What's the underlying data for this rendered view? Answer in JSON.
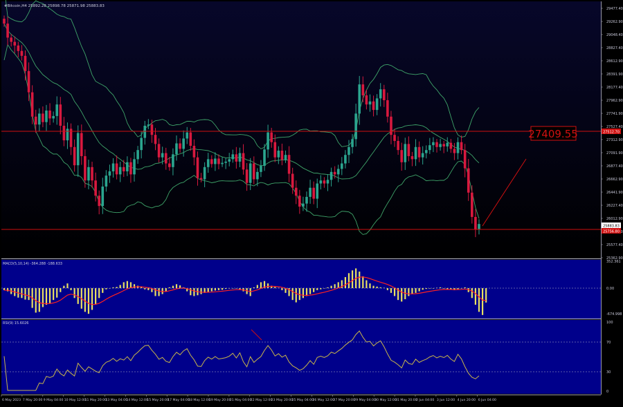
{
  "colors": {
    "main_bg_top": "#07072a",
    "main_bg_bottom": "#000000",
    "ind_bg": "#00008b",
    "bull": "#2ba58f",
    "bear": "#d8193e",
    "bands": "#3fa56a",
    "hline": "#d01010",
    "macd_hist": "#e8e062",
    "macd_signal": "#ff2020",
    "rsi_line": "#c9b64a",
    "axis_text": "#c8c8d8",
    "separator": "#b8b8c8"
  },
  "header": {
    "main_title": "#Bitcoin,H4  25892.28 25898.78 25871.98 25883.83",
    "macd_title": "MACD(5,10,14) -364.288 -188.633",
    "rsi_title": "RSI(9) 15.6026"
  },
  "price_axis": [
    "29477.40",
    "29262.90",
    "29048.40",
    "28827.40",
    "28612.90",
    "28391.90",
    "28177.40",
    "27962.90",
    "27741.90",
    "27527.40",
    "27312.90",
    "27091.90",
    "26877.40",
    "26662.90",
    "26441.90",
    "26227.40",
    "26012.90",
    "25798.40",
    "25577.40",
    "25362.90"
  ],
  "price_tags": {
    "level_high": "27512.70",
    "current": "25883.83",
    "level_low": "25756.80"
  },
  "big_label": "27409.55",
  "macd_axis": [
    "352.361",
    "0.00",
    "-674.998"
  ],
  "rsi_axis": [
    "100",
    "70",
    "30",
    "0"
  ],
  "time_axis": [
    "6 May 2023",
    "7 May 20:00",
    "9 May 04:00",
    "10 May 12:00",
    "11 May 20:00",
    "13 May 04:00",
    "14 May 12:00",
    "15 May 20:00",
    "17 May 04:00",
    "18 May 12:00",
    "19 May 20:00",
    "21 May 04:00",
    "22 May 12:00",
    "23 May 20:00",
    "25 May 04:00",
    "26 May 12:00",
    "27 May 20:00",
    "29 May 04:00",
    "30 May 12:00",
    "31 May 20:00",
    "2 Jun 04:00",
    "3 Jun 12:00",
    "4 Jun 20:00",
    "6 Jun 04:00"
  ],
  "chart_data": {
    "type": "candlestick",
    "symbol": "#Bitcoin",
    "timeframe": "H4",
    "price_range": [
      25362.9,
      29477.4
    ],
    "horizontal_levels": [
      27409.55,
      25830.0
    ],
    "closes": [
      29180,
      28950,
      28880,
      28820,
      28730,
      28650,
      28400,
      28050,
      27650,
      27520,
      27700,
      27560,
      27750,
      27620,
      27660,
      27850,
      27500,
      27260,
      27450,
      27150,
      26850,
      27380,
      27000,
      26600,
      26820,
      26600,
      26350,
      26180,
      26500,
      26680,
      26750,
      26880,
      26700,
      26820,
      26750,
      26900,
      26700,
      26950,
      27100,
      27300,
      27500,
      27520,
      27350,
      27200,
      26980,
      27050,
      26880,
      26820,
      27030,
      27210,
      27120,
      27290,
      27390,
      27170,
      26980,
      26640,
      26620,
      26820,
      26950,
      26870,
      26960,
      26870,
      26890,
      26910,
      26950,
      27030,
      26910,
      27050,
      26780,
      26560,
      26880,
      26620,
      26740,
      26840,
      27110,
      27390,
      27230,
      26980,
      27090,
      26940,
      27020,
      26710,
      26480,
      26350,
      26170,
      26220,
      26330,
      26480,
      26300,
      26550,
      26600,
      26550,
      26610,
      26740,
      26700,
      26790,
      26880,
      27020,
      27150,
      27280,
      27700,
      28180,
      28000,
      27850,
      27900,
      27760,
      27950,
      28100,
      27920,
      27650,
      27350,
      27250,
      27100,
      26900,
      27200,
      27000,
      26950,
      27150,
      26980,
      27050,
      27100,
      27180,
      27230,
      27150,
      27200,
      27160,
      27220,
      27120,
      27050,
      27230,
      27100,
      26800,
      26400,
      26000,
      25800,
      25883.83
    ],
    "macd_hist": [
      -50,
      -80,
      -150,
      -200,
      -240,
      -250,
      -290,
      -300,
      -500,
      -620,
      -600,
      -480,
      -420,
      -380,
      -300,
      -240,
      -100,
      60,
      120,
      -50,
      -250,
      -400,
      -520,
      -600,
      -650,
      -550,
      -400,
      -250,
      -120,
      -30,
      -10,
      20,
      30,
      80,
      150,
      180,
      150,
      100,
      60,
      40,
      -30,
      -50,
      -100,
      -200,
      -200,
      -150,
      -80,
      20,
      60,
      100,
      70,
      20,
      -80,
      -180,
      -200,
      -180,
      -150,
      -120,
      -100,
      -80,
      -60,
      -50,
      -40,
      -20,
      -10,
      -5,
      -3,
      -30,
      -80,
      -150,
      -200,
      20,
      80,
      150,
      180,
      120,
      60,
      30,
      10,
      -50,
      -120,
      -200,
      -300,
      -360,
      -300,
      -250,
      -200,
      -150,
      -100,
      -50,
      -30,
      -10,
      20,
      60,
      100,
      150,
      200,
      280,
      380,
      450,
      500,
      420,
      300,
      200,
      120,
      60,
      40,
      20,
      10,
      -50,
      -120,
      -200,
      -300,
      -340,
      -280,
      -200,
      -150,
      -120,
      -80,
      -40,
      -20,
      -10,
      0,
      10,
      20,
      -5,
      -30,
      -40,
      -50,
      -30,
      -10,
      20,
      -100,
      -250,
      -420,
      -600,
      -680,
      -364
    ]
  }
}
